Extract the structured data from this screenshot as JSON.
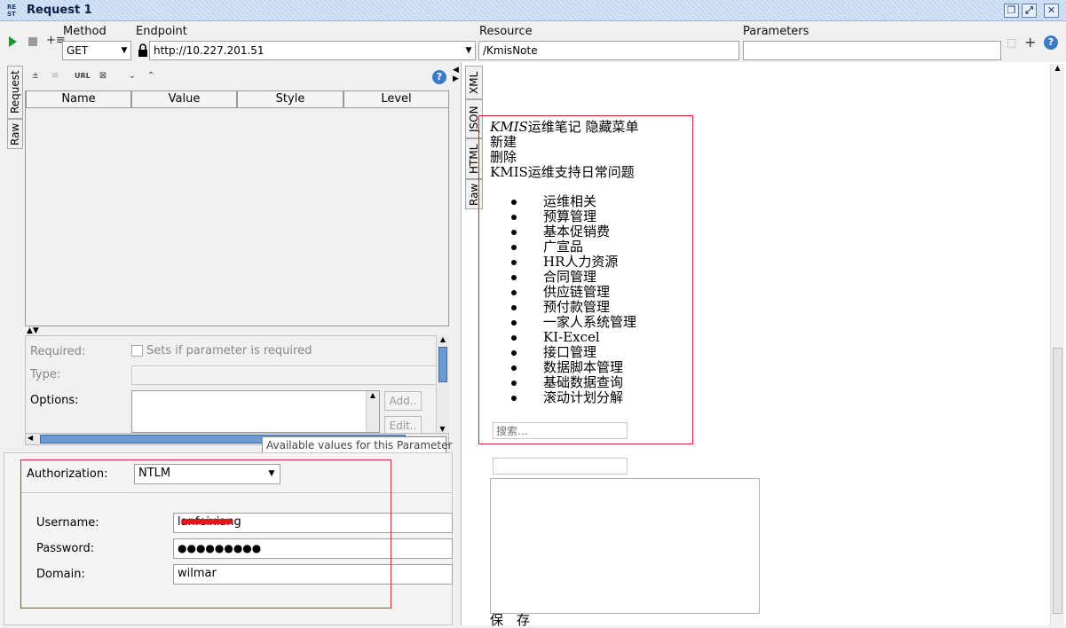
{
  "window": {
    "icon_text_top": "RE",
    "icon_text_bottom": "ST",
    "title": "Request 1",
    "buttons": [
      "restore-icon",
      "maximize-icon",
      "close-icon"
    ]
  },
  "toolbar": {
    "method_label": "Method",
    "method_value": "GET",
    "endpoint_label": "Endpoint",
    "endpoint_value": "http://10.227.201.51",
    "resource_label": "Resource",
    "resource_value": "/KmisNote",
    "parameters_label": "Parameters",
    "parameters_value": ""
  },
  "left_tabs": [
    "Request",
    "Raw"
  ],
  "param_table": {
    "columns": [
      "Name",
      "Value",
      "Style",
      "Level"
    ]
  },
  "param_details": {
    "required_label": "Required:",
    "required_checkbox_text": "Sets if parameter is required",
    "type_label": "Type:",
    "options_label": "Options:",
    "add_button": "Add..",
    "edit_button": "Edit..",
    "tooltip": "Available values for this Parameter"
  },
  "auth": {
    "authorization_label": "Authorization:",
    "authorization_value": "NTLM",
    "username_label": "Username:",
    "username_value": "lanfeixiang",
    "password_label": "Password:",
    "password_value": "●●●●●●●●●",
    "domain_label": "Domain:",
    "domain_value": "wilmar"
  },
  "right_tabs": [
    "XML",
    "JSON",
    "HTML",
    "Raw"
  ],
  "html_view": {
    "header_italic": "KMIS",
    "header_rest": "运维笔记 隐藏菜单",
    "line_new": "新建",
    "line_delete": "删除",
    "line_section": "KMIS运维支持日常问题",
    "menu_items": [
      "运维相关",
      "预算管理",
      "基本促销费",
      "广宣品",
      "HR人力资源",
      "合同管理",
      "供应链管理",
      "预付款管理",
      "一家人系统管理",
      "KI-Excel",
      "接口管理",
      "数据脚本管理",
      "基础数据查询",
      "滚动计划分解"
    ],
    "search_placeholder": "搜索...",
    "save_text": "保　存"
  }
}
